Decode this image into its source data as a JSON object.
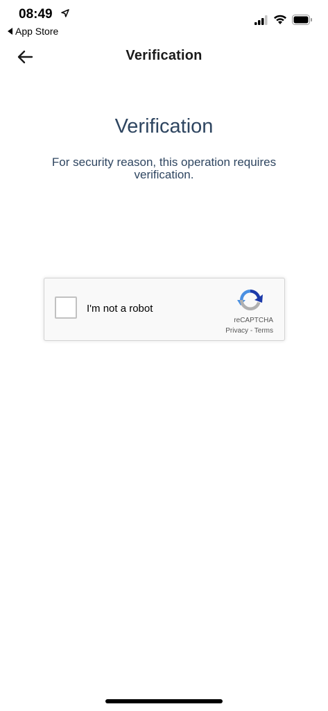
{
  "status_bar": {
    "time": "08:49",
    "back_app_label": "App Store"
  },
  "nav": {
    "title": "Verification"
  },
  "content": {
    "heading": "Verification",
    "subtitle": "For security reason, this operation requires verification."
  },
  "recaptcha": {
    "label": "I'm not a robot",
    "brand": "reCAPTCHA",
    "privacy_link": "Privacy",
    "separator": " - ",
    "terms_link": "Terms"
  },
  "colors": {
    "heading_text": "#2e4560",
    "captcha_blue": "#4a90e2",
    "captcha_dark_blue": "#1c3aa9",
    "captcha_grey": "#b0b0b0"
  }
}
